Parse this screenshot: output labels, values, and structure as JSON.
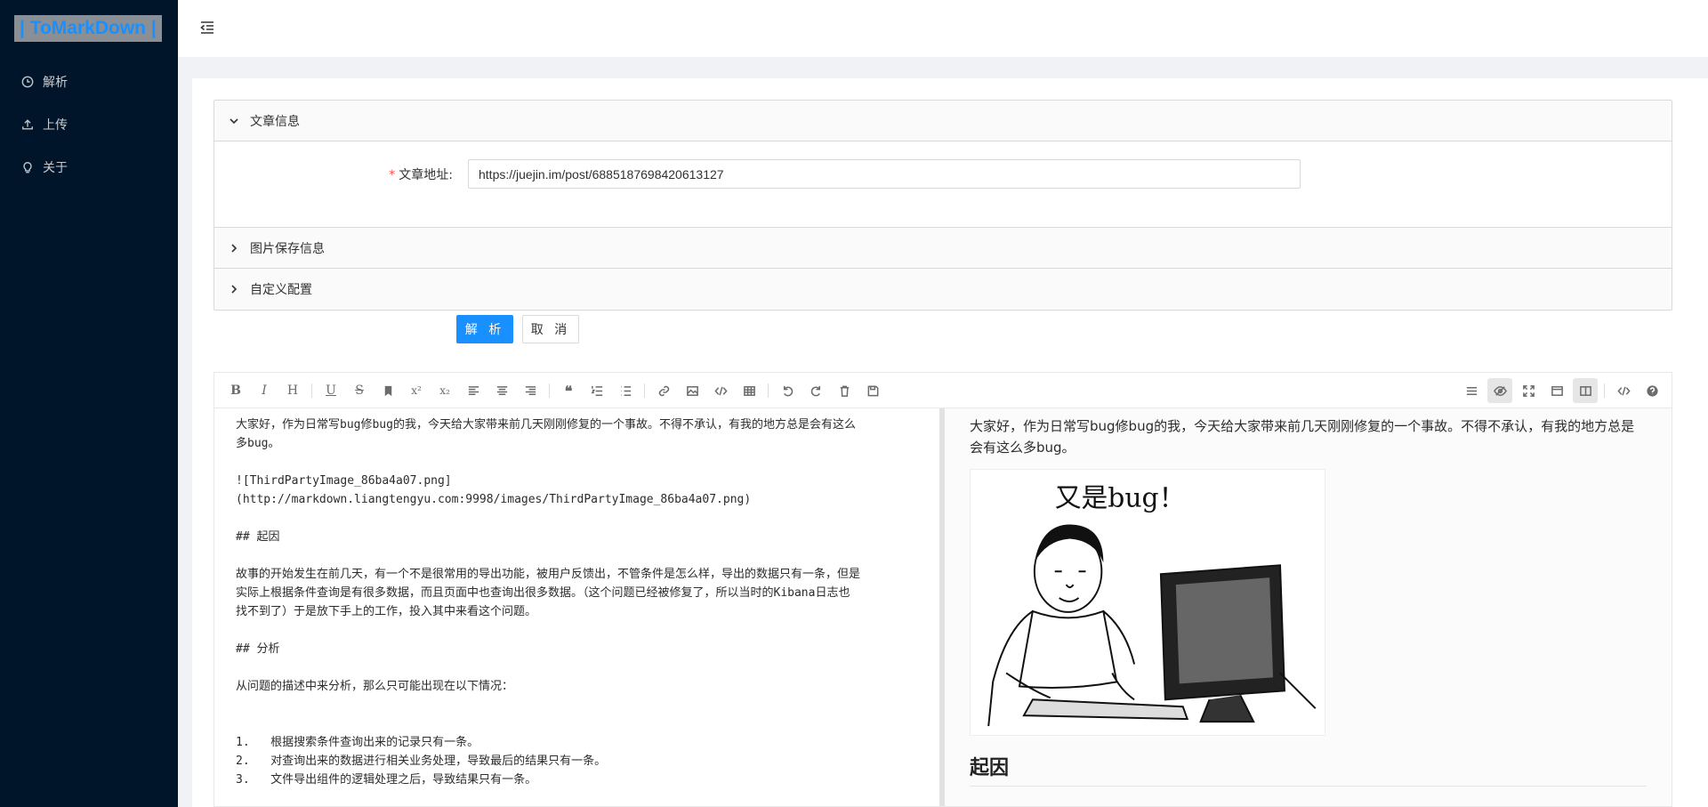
{
  "app": {
    "logo_text": "| ToMarkDown |"
  },
  "sidebar": {
    "items": [
      {
        "label": "解析",
        "icon": "clock-icon"
      },
      {
        "label": "上传",
        "icon": "upload-icon"
      },
      {
        "label": "关于",
        "icon": "bulb-icon"
      }
    ]
  },
  "collapse": {
    "panels": [
      {
        "title": "文章信息",
        "expanded": true
      },
      {
        "title": "图片保存信息",
        "expanded": false
      },
      {
        "title": "自定义配置",
        "expanded": false
      }
    ],
    "article_url_label": "文章地址:",
    "article_url_value": "https://juejin.im/post/6885187698420613127"
  },
  "actions": {
    "parse_label": "解 析",
    "cancel_label": "取 消"
  },
  "editor": {
    "toolbar_left": [
      "B",
      "I",
      "H",
      "U",
      "S",
      "bookmark",
      "x²",
      "x₂",
      "align-left",
      "align-center",
      "align-right",
      "quote",
      "ordered-list",
      "unordered-list",
      "link",
      "image",
      "code",
      "table",
      "undo",
      "redo",
      "trash",
      "save"
    ],
    "toolbar_right": [
      "navigation",
      "preview-toggle",
      "fullscreen",
      "window",
      "subfield",
      "source",
      "help"
    ],
    "source_lines": {
      "l1": "大家好，作为日常写bug修bug的我，今天给大家带来前几天刚刚修复的一个事故。不得不承认，有我的地方总是会有这么",
      "l2": "多bug。",
      "l3": "![ThirdPartyImage_86ba4a07.png]",
      "l4": "(http://markdown.liangtengyu.com:9998/images/ThirdPartyImage_86ba4a07.png)",
      "l5": "## 起因",
      "l6": "故事的开始发生在前几天，有一个不是很常用的导出功能，被用户反馈出，不管条件是怎么样，导出的数据只有一条，但是",
      "l7": "实际上根据条件查询是有很多数据，而且页面中也查询出很多数据。（这个问题已经被修复了，所以当时的Kibana日志也",
      "l8": "找不到了）于是放下手上的工作，投入其中来看这个问题。",
      "l9": "## 分析",
      "l10": "从问题的描述中来分析，那么只可能出现在以下情况：",
      "l11": "1.   根据搜索条件查询出来的记录只有一条。",
      "l12": "2.   对查询出来的数据进行相关业务处理，导致最后的结果只有一条。",
      "l13": "3.   文件导出组件的逻辑处理之后，导致结果只有一条。"
    },
    "preview": {
      "para1": "大家好，作为日常写bug修bug的我，今天给大家带来前几天刚刚修复的一个事故。不得不承认，有我的地方总是会有这么多bug。",
      "image_caption": "又是bug！",
      "heading1": "起因"
    }
  },
  "colors": {
    "sidebar_bg": "#001529",
    "primary": "#1890ff",
    "logo_text": "#1890ff"
  }
}
